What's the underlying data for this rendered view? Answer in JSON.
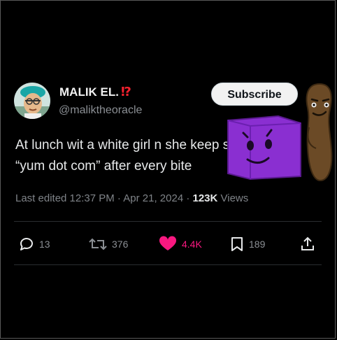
{
  "author": {
    "name": "MALIK EL.",
    "name_mark": "⁉",
    "handle": "@maliktheoracle"
  },
  "subscribe_label": "Subscribe",
  "tweet": {
    "line1": "At lunch wit a white girl n she keep saying",
    "line2": "“yum dot com” after every bite"
  },
  "meta": {
    "edited": "Last edited 12:37 PM · Apr 21, 2024 · ",
    "views_count": "123K",
    "views_label": " Views"
  },
  "actions": {
    "replies": "13",
    "reposts": "376",
    "likes": "4.4K",
    "bookmarks": "189"
  },
  "colors": {
    "like": "#f91880",
    "purple_sticker": "#8a2fd1",
    "peanut_sticker": "#6b4a26"
  },
  "icons": [
    "reply-icon",
    "repost-icon",
    "heart-icon",
    "bookmark-icon",
    "share-icon"
  ]
}
